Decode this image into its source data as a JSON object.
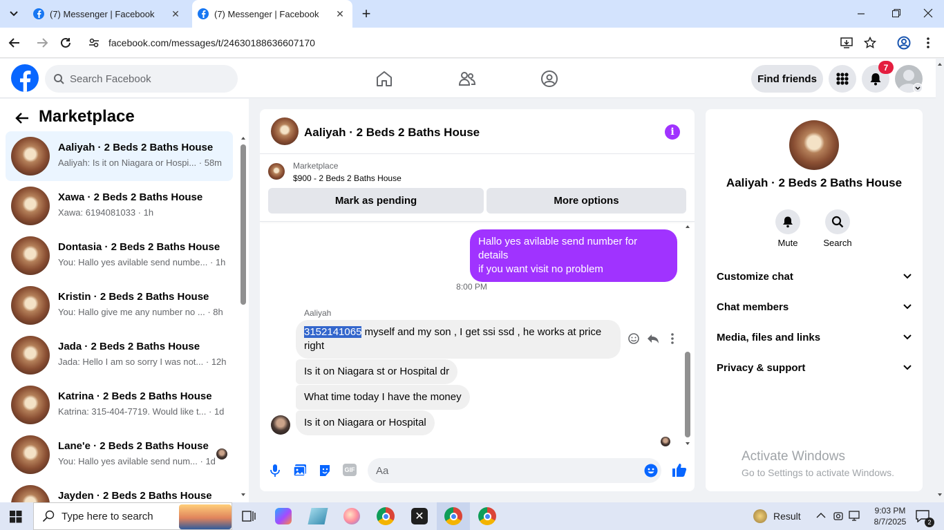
{
  "browser": {
    "tabs": [
      {
        "title": "(7) Messenger | Facebook",
        "active": false
      },
      {
        "title": "(7) Messenger | Facebook",
        "active": true
      }
    ],
    "url": "facebook.com/messages/t/24630188636607170"
  },
  "fb_header": {
    "search_placeholder": "Search Facebook",
    "find_friends": "Find friends",
    "notification_count": "7"
  },
  "sidebar": {
    "title": "Marketplace",
    "conversations": [
      {
        "name": "Aaliyah · 2 Beds 2 Baths House",
        "preview": "Aaliyah: Is it on Niagara or Hospi...",
        "time": "· 58m",
        "selected": true
      },
      {
        "name": "Xawa · 2 Beds 2 Baths House",
        "preview": "Xawa: 6194081033",
        "time": "· 1h"
      },
      {
        "name": "Dontasia · 2 Beds 2 Baths House",
        "preview": "You: Hallo yes avilable send numbe...",
        "time": "· 1h"
      },
      {
        "name": "Kristin · 2 Beds 2 Baths House",
        "preview": "You: Hallo give me any number no ...",
        "time": "· 8h"
      },
      {
        "name": "Jada · 2 Beds 2 Baths House",
        "preview": "Jada: Hello I am so sorry I was not...",
        "time": "· 12h"
      },
      {
        "name": "Katrina · 2 Beds 2 Baths House",
        "preview": "Katrina: 315-404-7719. Would like t...",
        "time": "· 1d"
      },
      {
        "name": "Lane'e · 2 Beds 2 Baths House",
        "preview": "You: Hallo yes avilable send num...",
        "time": "· 1d"
      },
      {
        "name": "Jayden · 2 Beds 2 Baths House",
        "preview": "",
        "time": ""
      }
    ]
  },
  "chat": {
    "title": "Aaliyah · 2 Beds 2 Baths House",
    "listing_source": "Marketplace",
    "listing_price": "$900 - 2 Beds 2 Baths House",
    "mark_pending": "Mark as pending",
    "more_options": "More options",
    "outgoing_message": "Hallo yes avilable send number for details\n if you want visit no problem",
    "timestamp": "8:00 PM",
    "sender": "Aaliyah",
    "highlighted_number": "3152141065",
    "message1_rest": " myself and my son , I get ssi ssd , he works at price right",
    "message2": "Is it on Niagara st or Hospital dr",
    "message3": "What time today I have the money",
    "message4": "Is it on Niagara or Hospital",
    "composer_placeholder": "Aa"
  },
  "info_panel": {
    "name": "Aaliyah · 2 Beds 2 Baths House",
    "mute": "Mute",
    "search": "Search",
    "sections": [
      "Customize chat",
      "Chat members",
      "Media, files and links",
      "Privacy & support"
    ],
    "watermark_title": "Activate Windows",
    "watermark_sub": "Go to Settings to activate Windows."
  },
  "taskbar": {
    "search_placeholder": "Type here to search",
    "result_label": "Result",
    "time": "9:03 PM",
    "date": "8/7/2025",
    "notif_badge": "2"
  },
  "colors": {
    "accent": "#1877f2",
    "messenger_purple": "#a033ff",
    "highlight": "#3366cc"
  }
}
